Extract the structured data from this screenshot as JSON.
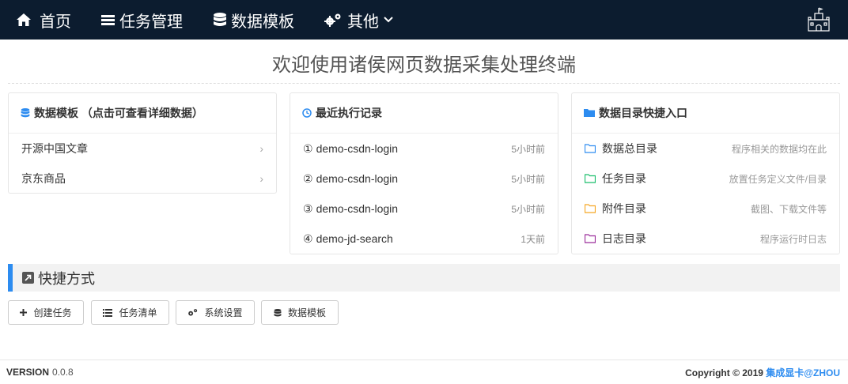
{
  "nav": {
    "home": "首页",
    "tasks": "任务管理",
    "templates": "数据模板",
    "other": "其他"
  },
  "page_title": "欢迎使用诸侯网页数据采集处理终端",
  "templates_panel": {
    "title": "数据模板 （点击可查看详细数据）",
    "items": [
      {
        "label": "开源中国文章"
      },
      {
        "label": "京东商品"
      }
    ]
  },
  "records_panel": {
    "title": "最近执行记录",
    "items": [
      {
        "index": "①",
        "name": "demo-csdn-login",
        "time": "5小时前"
      },
      {
        "index": "②",
        "name": "demo-csdn-login",
        "time": "5小时前"
      },
      {
        "index": "③",
        "name": "demo-csdn-login",
        "time": "5小时前"
      },
      {
        "index": "④",
        "name": "demo-jd-search",
        "time": "1天前"
      }
    ]
  },
  "dirs_panel": {
    "title": "数据目录快捷入口",
    "items": [
      {
        "label": "数据总目录",
        "note": "程序相关的数据均在此",
        "color": "#2d8cf0"
      },
      {
        "label": "任务目录",
        "note": "放置任务定义文件/目录",
        "color": "#19be6b"
      },
      {
        "label": "附件目录",
        "note": "截图、下载文件等",
        "color": "#f5a623"
      },
      {
        "label": "日志目录",
        "note": "程序运行时日志",
        "color": "#9b2c9b"
      }
    ]
  },
  "shortcuts": {
    "title": "快捷方式",
    "buttons": {
      "create": "创建任务",
      "tasklist": "任务清单",
      "settings": "系统设置",
      "templates": "数据模板"
    }
  },
  "footer": {
    "version_label": "VERSION",
    "version": "0.0.8",
    "copyright": "Copyright © 2019",
    "link": "集成显卡@ZHOU"
  },
  "colors": {
    "nav_bg": "#0c1c2f",
    "accent": "#2d8cf0"
  }
}
